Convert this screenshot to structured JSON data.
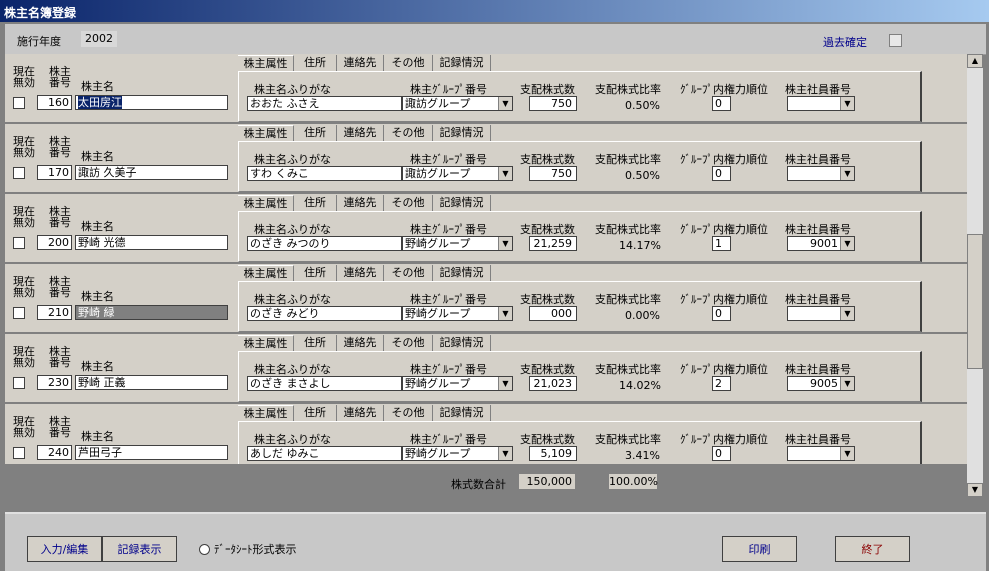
{
  "window": {
    "title": "株主名簿登録"
  },
  "header": {
    "fiscal_year_label": "施行年度",
    "fiscal_year_value": "2002",
    "past_confirm_label": "過去確定"
  },
  "list_labels": {
    "current": "現在",
    "invalid": "無効",
    "shareholder": "株主",
    "number": "番号",
    "name": "株主名"
  },
  "tabs": [
    "株主属性",
    "住所",
    "連絡先",
    "その他",
    "記録情況"
  ],
  "columns": {
    "furigana": "株主名ふりがな",
    "group_no": "株主ｸﾞﾙｰﾌﾟ番号",
    "shares": "支配株式数",
    "ratio": "支配株式比率",
    "rank": "ｸﾞﾙｰﾌﾟ内権力順位",
    "employee_no": "株主社員番号"
  },
  "records": [
    {
      "number": "160",
      "name": "太田房江",
      "furigana": "おおた ふさえ",
      "group": "諏訪グループ",
      "shares": "750",
      "ratio": "0.50%",
      "rank": "0",
      "employee_no": ""
    },
    {
      "number": "170",
      "name": "諏訪 久美子",
      "furigana": "すわ くみこ",
      "group": "諏訪グループ",
      "shares": "750",
      "ratio": "0.50%",
      "rank": "0",
      "employee_no": ""
    },
    {
      "number": "200",
      "name": "野崎 光德",
      "furigana": "のざき みつのり",
      "group": "野崎グループ",
      "shares": "21,259",
      "ratio": "14.17%",
      "rank": "1",
      "employee_no": "9001"
    },
    {
      "number": "210",
      "name": "野崎 緑",
      "furigana": "のざき みどり",
      "group": "野崎グループ",
      "shares": "000",
      "ratio": "0.00%",
      "rank": "0",
      "employee_no": ""
    },
    {
      "number": "230",
      "name": "野崎 正義",
      "furigana": "のざき まさよし",
      "group": "野崎グループ",
      "shares": "21,023",
      "ratio": "14.02%",
      "rank": "2",
      "employee_no": "9005"
    },
    {
      "number": "240",
      "name": "芦田弓子",
      "furigana": "あしだ ゆみこ",
      "group": "野崎グループ",
      "shares": "5,109",
      "ratio": "3.41%",
      "rank": "0",
      "employee_no": ""
    }
  ],
  "totals": {
    "label": "株式数合計",
    "shares": "150,000",
    "ratio": "100.00%"
  },
  "footer": {
    "input_edit": "入力/編集",
    "record_view": "記録表示",
    "datasheet": "ﾃﾞｰﾀｼｰﾄ形式表示",
    "print": "印刷",
    "exit": "終了"
  }
}
